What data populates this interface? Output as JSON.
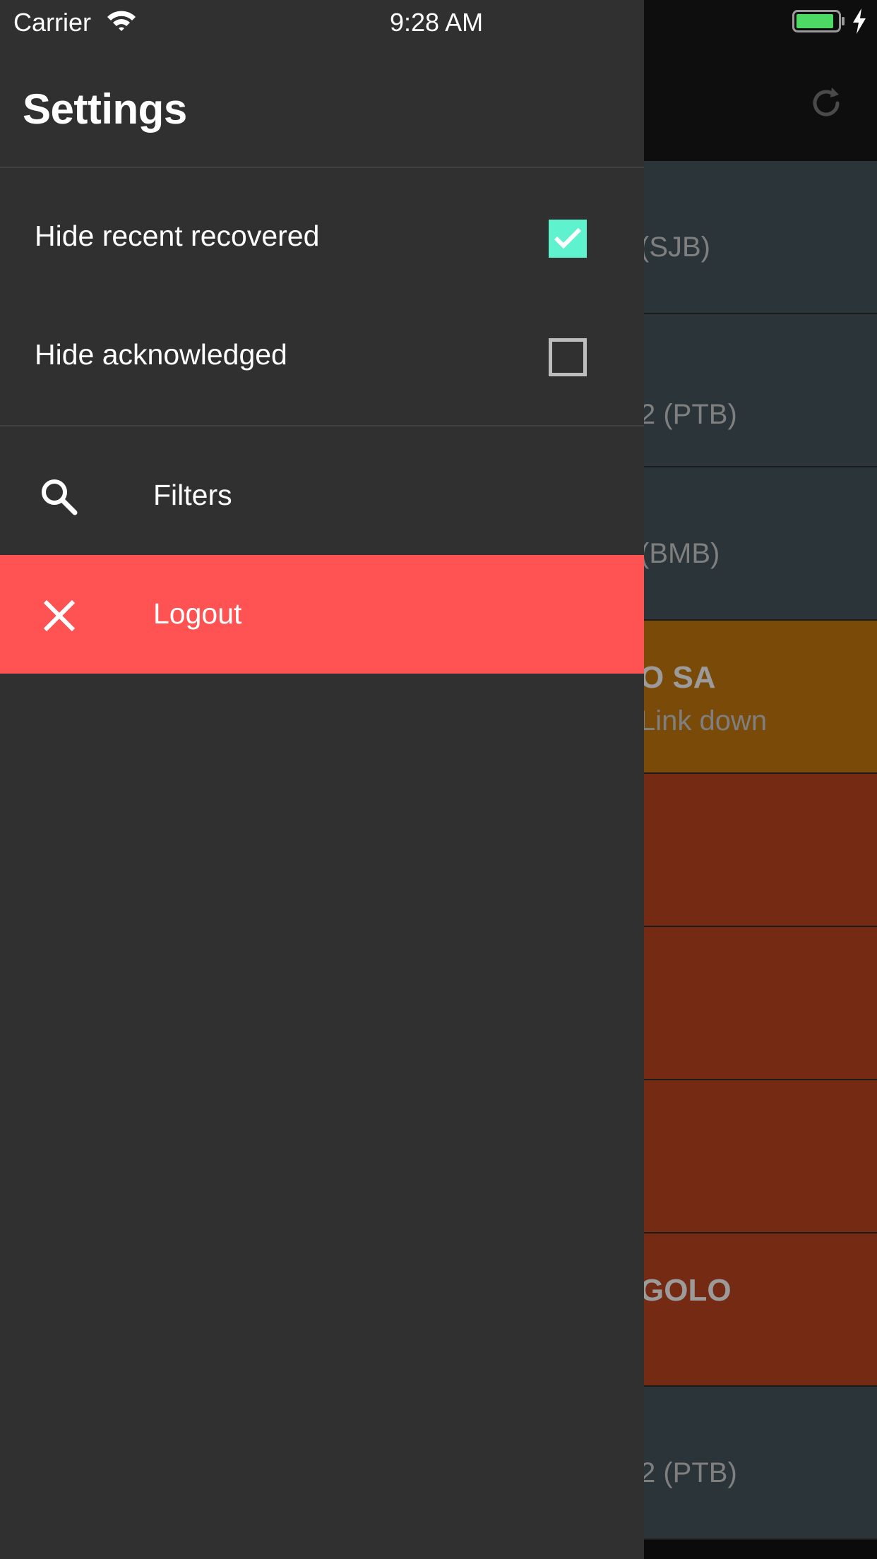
{
  "status_bar": {
    "carrier": "Carrier",
    "time": "9:28 AM"
  },
  "drawer": {
    "title": "Settings",
    "toggles": [
      {
        "label": "Hide recent recovered",
        "checked": true
      },
      {
        "label": "Hide acknowledged",
        "checked": false
      }
    ],
    "nav": [
      {
        "label": "Filters",
        "icon": "search-icon"
      },
      {
        "label": "Logout",
        "icon": "close-icon"
      }
    ]
  },
  "background_list": {
    "rows": [
      {
        "title": "",
        "subtitle": "(SJB)",
        "color": "#2b3438"
      },
      {
        "title": "",
        "subtitle": "2 (PTB)",
        "color": "#2b3438"
      },
      {
        "title": "",
        "subtitle": "(BMB)",
        "color": "#2b3438"
      },
      {
        "title": "O SA",
        "subtitle": "Link down",
        "color": "#7a4a08"
      },
      {
        "title": "",
        "subtitle": "",
        "color": "#752a13"
      },
      {
        "title": "",
        "subtitle": "",
        "color": "#752a13"
      },
      {
        "title": "",
        "subtitle": "",
        "color": "#752a13"
      },
      {
        "title": "GOLO",
        "subtitle": "",
        "color": "#752a13"
      },
      {
        "title": "",
        "subtitle": "2 (PTB)",
        "color": "#2b3438"
      }
    ]
  },
  "colors": {
    "drawer_bg": "#303030",
    "accent_check": "#5ef2cf",
    "logout_bg": "#ff5353",
    "battery_fill": "#4cd964"
  }
}
